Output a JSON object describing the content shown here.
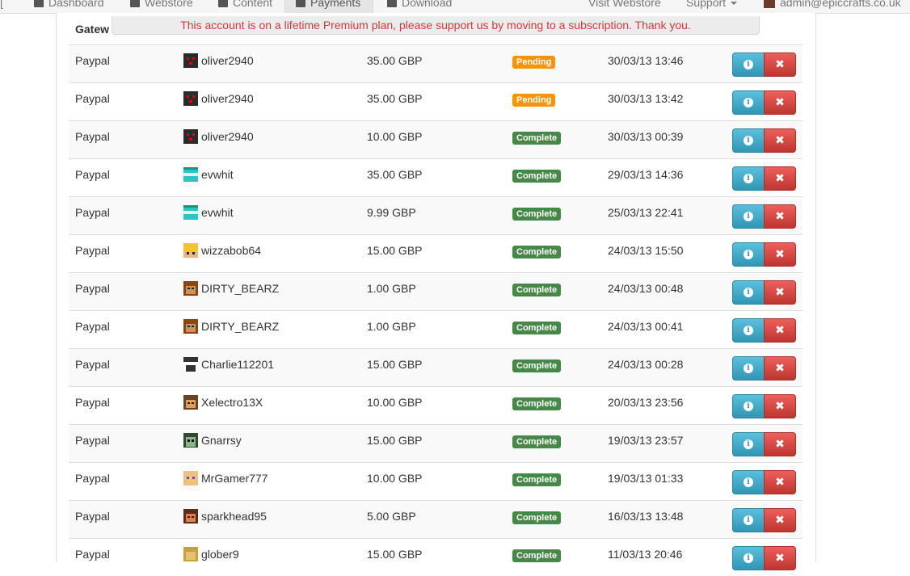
{
  "nav": {
    "dashboard": "Dashboard",
    "webstore": "Webstore",
    "content": "Content",
    "payments": "Payments",
    "download": "Download",
    "visit_webstore": "Visit Webstore",
    "support": "Support",
    "account": "admin@epiccrafts.co.uk"
  },
  "alert": "This account is on a lifetime Premium plan, please support us by moving to a subscription. Thank you.",
  "table": {
    "header_gateway": "Gatew",
    "rows": [
      {
        "gateway": "Paypal",
        "user": "oliver2940",
        "amount": "35.00 GBP",
        "status": "Pending",
        "date": "30/03/13 13:46",
        "face": "oliver"
      },
      {
        "gateway": "Paypal",
        "user": "oliver2940",
        "amount": "35.00 GBP",
        "status": "Pending",
        "date": "30/03/13 13:42",
        "face": "oliver"
      },
      {
        "gateway": "Paypal",
        "user": "oliver2940",
        "amount": "10.00 GBP",
        "status": "Complete",
        "date": "30/03/13 00:39",
        "face": "oliver"
      },
      {
        "gateway": "Paypal",
        "user": "evwhit",
        "amount": "35.00 GBP",
        "status": "Complete",
        "date": "29/03/13 14:36",
        "face": "evwhit"
      },
      {
        "gateway": "Paypal",
        "user": "evwhit",
        "amount": "9.99 GBP",
        "status": "Complete",
        "date": "25/03/13 22:41",
        "face": "evwhit"
      },
      {
        "gateway": "Paypal",
        "user": "wizzabob64",
        "amount": "15.00 GBP",
        "status": "Complete",
        "date": "24/03/13 15:50",
        "face": "wizza"
      },
      {
        "gateway": "Paypal",
        "user": "DIRTY_BEARZ",
        "amount": "1.00 GBP",
        "status": "Complete",
        "date": "24/03/13 00:48",
        "face": "bear"
      },
      {
        "gateway": "Paypal",
        "user": "DIRTY_BEARZ",
        "amount": "1.00 GBP",
        "status": "Complete",
        "date": "24/03/13 00:41",
        "face": "bear"
      },
      {
        "gateway": "Paypal",
        "user": "Charlie112201",
        "amount": "15.00 GBP",
        "status": "Complete",
        "date": "24/03/13 00:28",
        "face": "charlie"
      },
      {
        "gateway": "Paypal",
        "user": "Xelectro13X",
        "amount": "10.00 GBP",
        "status": "Complete",
        "date": "20/03/13 23:56",
        "face": "xelectro"
      },
      {
        "gateway": "Paypal",
        "user": "Gnarrsy",
        "amount": "15.00 GBP",
        "status": "Complete",
        "date": "19/03/13 23:57",
        "face": "gnarrsy"
      },
      {
        "gateway": "Paypal",
        "user": "MrGamer777",
        "amount": "10.00 GBP",
        "status": "Complete",
        "date": "19/03/13 01:33",
        "face": "mrgamer"
      },
      {
        "gateway": "Paypal",
        "user": "sparkhead95",
        "amount": "5.00 GBP",
        "status": "Complete",
        "date": "16/03/13 13:48",
        "face": "spark"
      },
      {
        "gateway": "Paypal",
        "user": "glober9",
        "amount": "15.00 GBP",
        "status": "Complete",
        "date": "11/03/13 20:46",
        "face": "glober"
      }
    ]
  },
  "colors": {
    "pending": "#f89406",
    "complete": "#468847",
    "info_button": "#2f96b4",
    "danger_button": "#bd362f",
    "alert_text": "#d23a3a"
  },
  "icons": {
    "info": "info-icon",
    "delete": "remove-icon"
  }
}
